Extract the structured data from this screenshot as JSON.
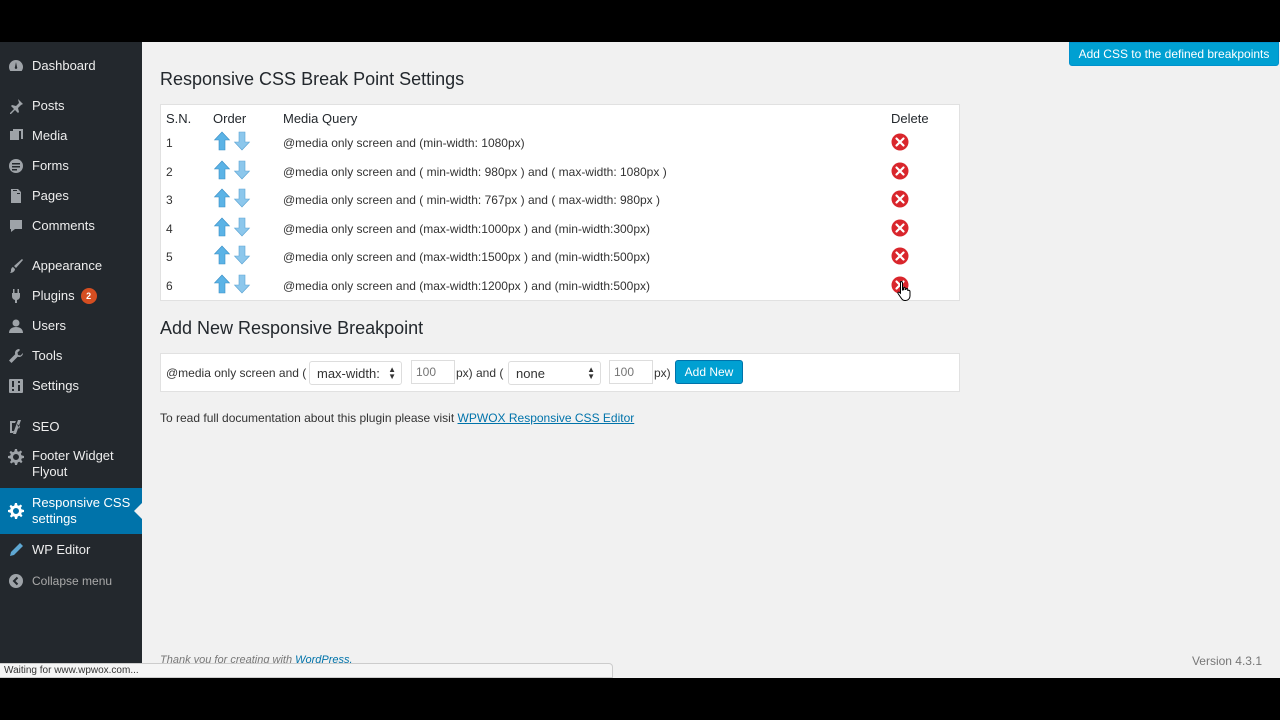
{
  "sidebar": {
    "items": [
      {
        "label": "Dashboard",
        "icon": "dashboard-icon"
      },
      {
        "label": "Posts",
        "icon": "pin-icon"
      },
      {
        "label": "Media",
        "icon": "media-icon"
      },
      {
        "label": "Forms",
        "icon": "forms-icon"
      },
      {
        "label": "Pages",
        "icon": "page-icon"
      },
      {
        "label": "Comments",
        "icon": "comment-icon"
      },
      {
        "label": "Appearance",
        "icon": "brush-icon"
      },
      {
        "label": "Plugins",
        "icon": "plug-icon",
        "badge": "2"
      },
      {
        "label": "Users",
        "icon": "user-icon"
      },
      {
        "label": "Tools",
        "icon": "wrench-icon"
      },
      {
        "label": "Settings",
        "icon": "settings-icon"
      },
      {
        "label": "SEO",
        "icon": "seo-icon"
      },
      {
        "label": "Footer Widget Flyout",
        "icon": "gear-icon"
      },
      {
        "label": "Responsive CSS settings",
        "icon": "gear-icon",
        "current": true
      },
      {
        "label": "WP Editor",
        "icon": "pencil-icon"
      }
    ],
    "collapse_label": "Collapse menu"
  },
  "top_button": "Add CSS to the defined breakpoints",
  "breakpoints_section": {
    "title": "Responsive CSS Break Point Settings",
    "headers": {
      "sn": "S.N.",
      "order": "Order",
      "query": "Media Query",
      "delete": "Delete"
    },
    "rows": [
      {
        "sn": "1",
        "query": "@media only screen and (min-width: 1080px)"
      },
      {
        "sn": "2",
        "query": "@media only screen and ( min-width: 980px ) and ( max-width: 1080px )"
      },
      {
        "sn": "3",
        "query": "@media only screen and ( min-width: 767px ) and ( max-width: 980px )"
      },
      {
        "sn": "4",
        "query": "@media only screen and (max-width:1000px ) and (min-width:300px)"
      },
      {
        "sn": "5",
        "query": "@media only screen and (max-width:1500px ) and (min-width:500px)"
      },
      {
        "sn": "6",
        "query": "@media only screen and (max-width:1200px ) and (min-width:500px)"
      }
    ]
  },
  "add_section": {
    "title": "Add New Responsive Breakpoint",
    "prefix": "@media only screen and (",
    "select1": "max-width:",
    "input1_placeholder": "100",
    "mid": "px) and (",
    "select2": "none",
    "input2_placeholder": "100",
    "suffix": "px)",
    "button": "Add New"
  },
  "doc": {
    "text": "To read full documentation about this plugin please visit",
    "link": "WPWOX Responsive CSS Editor"
  },
  "footer": {
    "thanks": "Thank you for creating with",
    "link": "WordPress.",
    "version": "Version 4.3.1"
  },
  "status_bar": "Waiting for www.wpwox.com...",
  "colors": {
    "accent": "#00a0d2",
    "sidebar": "#23282d",
    "current": "#0073aa",
    "delete": "#d9262c"
  }
}
